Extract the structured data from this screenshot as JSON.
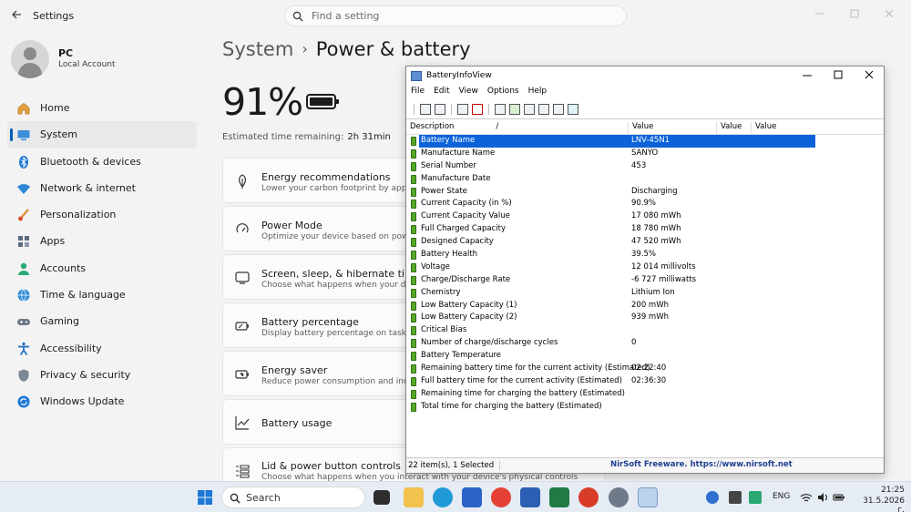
{
  "settings": {
    "app_title": "Settings",
    "search_placeholder": "Find a setting",
    "user": {
      "name": "PC",
      "account": "Local Account"
    },
    "nav": [
      {
        "label": "Home",
        "icon": "home-icon"
      },
      {
        "label": "System",
        "icon": "system-icon",
        "active": true
      },
      {
        "label": "Bluetooth & devices",
        "icon": "bluetooth-icon"
      },
      {
        "label": "Network & internet",
        "icon": "wifi-icon"
      },
      {
        "label": "Personalization",
        "icon": "brush-icon"
      },
      {
        "label": "Apps",
        "icon": "apps-icon"
      },
      {
        "label": "Accounts",
        "icon": "accounts-icon"
      },
      {
        "label": "Time & language",
        "icon": "globe-icon"
      },
      {
        "label": "Gaming",
        "icon": "gamepad-icon"
      },
      {
        "label": "Accessibility",
        "icon": "accessibility-icon"
      },
      {
        "label": "Privacy & security",
        "icon": "shield-icon"
      },
      {
        "label": "Windows Update",
        "icon": "update-icon"
      }
    ],
    "breadcrumb": {
      "parent": "System",
      "separator": "›",
      "current": "Power & battery"
    },
    "battery_percent": "91%",
    "estimated_label": "Estimated time remaining:",
    "estimated_value": "2h 31min",
    "cards": [
      {
        "title": "Energy recommendations",
        "subtitle": "Lower your carbon footprint by applying",
        "icon": "leaf-icon"
      },
      {
        "title": "Power Mode",
        "subtitle": "Optimize your device based on power u",
        "icon": "power-mode-icon"
      },
      {
        "title": "Screen, sleep, & hibernate timeouts",
        "subtitle": "Choose what happens when your device",
        "icon": "screen-sleep-icon"
      },
      {
        "title": "Battery percentage",
        "subtitle": "Display battery percentage on taskbar",
        "icon": "battery-percentage-icon"
      },
      {
        "title": "Energy saver",
        "subtitle": "Reduce power consumption and increase",
        "icon": "energy-saver-icon"
      },
      {
        "title": "Battery usage",
        "subtitle": "",
        "icon": "battery-usage-icon"
      },
      {
        "title": "Lid & power button controls",
        "subtitle": "Choose what happens when you interact with your device's physical controls",
        "icon": "lid-controls-icon"
      }
    ]
  },
  "biv": {
    "title": "BatteryInfoView",
    "menu": [
      "File",
      "Edit",
      "View",
      "Options",
      "Help"
    ],
    "columns": [
      "Description",
      "/",
      "Value",
      "Value",
      "Value"
    ],
    "rows": [
      {
        "desc": "Battery Name",
        "value": "LNV-45N1",
        "selected": true
      },
      {
        "desc": "Manufacture Name",
        "value": "SANYO"
      },
      {
        "desc": "Serial Number",
        "value": " 453"
      },
      {
        "desc": "Manufacture Date",
        "value": ""
      },
      {
        "desc": "Power State",
        "value": "Discharging"
      },
      {
        "desc": "Current Capacity (in %)",
        "value": "90.9%"
      },
      {
        "desc": "Current Capacity Value",
        "value": "17 080 mWh"
      },
      {
        "desc": "Full Charged Capacity",
        "value": "18 780 mWh"
      },
      {
        "desc": "Designed Capacity",
        "value": "47 520 mWh"
      },
      {
        "desc": "Battery Health",
        "value": "39.5%"
      },
      {
        "desc": "Voltage",
        "value": "12 014 millivolts"
      },
      {
        "desc": "Charge/Discharge Rate",
        "value": "-6 727 milliwatts"
      },
      {
        "desc": "Chemistry",
        "value": "Lithium Ion"
      },
      {
        "desc": "Low Battery Capacity (1)",
        "value": "200 mWh"
      },
      {
        "desc": "Low Battery Capacity (2)",
        "value": "939 mWh"
      },
      {
        "desc": "Critical Bias",
        "value": ""
      },
      {
        "desc": "Number of charge/discharge cycles",
        "value": "0"
      },
      {
        "desc": "Battery Temperature",
        "value": ""
      },
      {
        "desc": "Remaining battery time for the current activity (Estimated)",
        "value": "02:22:40"
      },
      {
        "desc": "Full battery time for the current activity (Estimated)",
        "value": "02:36:30"
      },
      {
        "desc": "Remaining time for charging the battery (Estimated)",
        "value": ""
      },
      {
        "desc": "Total  time for charging the battery (Estimated)",
        "value": ""
      }
    ],
    "status_left": "22 item(s), 1 Selected",
    "status_right": "NirSoft Freeware. https://www.nirsoft.net"
  },
  "taskbar": {
    "search_placeholder": "Search",
    "language": "ENG",
    "time": "21:25",
    "date": "31.5.2026 г."
  }
}
